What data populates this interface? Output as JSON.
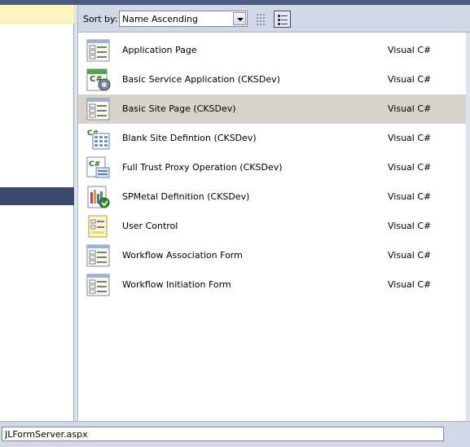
{
  "toolbar": {
    "sort_label": "Sort by:",
    "sort_value": "Name Ascending",
    "view_small_icon": "small-icons-view-icon",
    "view_large_icon": "medium-icons-view-icon"
  },
  "templates": [
    {
      "name": "Application Page",
      "language": "Visual C#",
      "icon": "page-form-icon",
      "selected": false
    },
    {
      "name": "Basic Service Application (CKSDev)",
      "language": "Visual C#",
      "icon": "csharp-service-icon",
      "selected": false
    },
    {
      "name": "Basic Site Page (CKSDev)",
      "language": "Visual C#",
      "icon": "page-form-icon",
      "selected": true
    },
    {
      "name": "Blank Site Defintion (CKSDev)",
      "language": "Visual C#",
      "icon": "csharp-grid-icon",
      "selected": false
    },
    {
      "name": "Full Trust Proxy Operation (CKSDev)",
      "language": "Visual C#",
      "icon": "csharp-proxy-icon",
      "selected": false
    },
    {
      "name": "SPMetal Definition (CKSDev)",
      "language": "Visual C#",
      "icon": "spmetal-icon",
      "selected": false
    },
    {
      "name": "User Control",
      "language": "Visual C#",
      "icon": "user-control-icon",
      "selected": false
    },
    {
      "name": "Workflow Association Form",
      "language": "Visual C#",
      "icon": "page-form-icon",
      "selected": false
    },
    {
      "name": "Workflow Initiation Form",
      "language": "Visual C#",
      "icon": "page-form-icon",
      "selected": false
    }
  ],
  "name_field": {
    "value": "JLFormServer.aspx"
  },
  "colors": {
    "selected_row": "#d7d3cb",
    "left_nav_selected": "#3b4b6e",
    "left_nav_highlight": "#fdf4bf"
  }
}
